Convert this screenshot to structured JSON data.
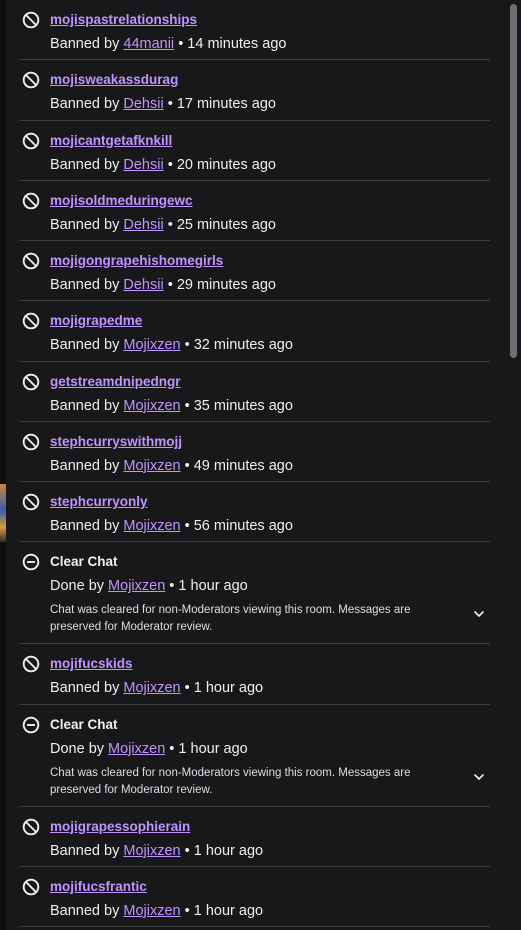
{
  "log": {
    "entries": [
      {
        "type": "ban",
        "icon": "ban-icon",
        "target": "mojispastrelationships",
        "action": "Banned by",
        "moderator": "44manii",
        "time": "14 minutes ago"
      },
      {
        "type": "ban",
        "icon": "ban-icon",
        "target": "mojisweakassdurag",
        "action": "Banned by",
        "moderator": "Dehsii",
        "time": "17 minutes ago"
      },
      {
        "type": "ban",
        "icon": "ban-icon",
        "target": "mojicantgetafknkill",
        "action": "Banned by",
        "moderator": "Dehsii",
        "time": "20 minutes ago"
      },
      {
        "type": "ban",
        "icon": "ban-icon",
        "target": "mojisoldmeduringewc",
        "action": "Banned by",
        "moderator": "Dehsii",
        "time": "25 minutes ago"
      },
      {
        "type": "ban",
        "icon": "ban-icon",
        "target": "mojigongrapehishomegirls",
        "action": "Banned by",
        "moderator": "Dehsii",
        "time": "29 minutes ago"
      },
      {
        "type": "ban",
        "icon": "ban-icon",
        "target": "mojigrapedme",
        "action": "Banned by",
        "moderator": "Mojixzen",
        "time": "32 minutes ago"
      },
      {
        "type": "ban",
        "icon": "ban-icon",
        "target": "getstreamdnipedngr",
        "action": "Banned by",
        "moderator": "Mojixzen",
        "time": "35 minutes ago"
      },
      {
        "type": "ban",
        "icon": "ban-icon",
        "target": "stephcurryswithmojj",
        "action": "Banned by",
        "moderator": "Mojixzen",
        "time": "49 minutes ago"
      },
      {
        "type": "ban",
        "icon": "ban-icon",
        "target": "stephcurryonly",
        "action": "Banned by",
        "moderator": "Mojixzen",
        "time": "56 minutes ago"
      },
      {
        "type": "clear",
        "icon": "clear-chat-icon",
        "target": "Clear Chat",
        "action": "Done by",
        "moderator": "Mojixzen",
        "time": "1 hour ago",
        "description": "Chat was cleared for non-Moderators viewing this room. Messages are preserved for Moderator review."
      },
      {
        "type": "ban",
        "icon": "ban-icon",
        "target": "mojifucskids",
        "action": "Banned by",
        "moderator": "Mojixzen",
        "time": "1 hour ago"
      },
      {
        "type": "clear",
        "icon": "clear-chat-icon",
        "target": "Clear Chat",
        "action": "Done by",
        "moderator": "Mojixzen",
        "time": "1 hour ago",
        "description": "Chat was cleared for non-Moderators viewing this room. Messages are preserved for Moderator review."
      },
      {
        "type": "ban",
        "icon": "ban-icon",
        "target": "mojigrapessophierain",
        "action": "Banned by",
        "moderator": "Mojixzen",
        "time": "1 hour ago"
      },
      {
        "type": "ban",
        "icon": "ban-icon",
        "target": "mojifucsfrantic",
        "action": "Banned by",
        "moderator": "Mojixzen",
        "time": "1 hour ago"
      }
    ]
  },
  "colors": {
    "background": "#18181b",
    "link": "#bf94ff",
    "text": "#efeff1",
    "divider": "#3a3a3d"
  }
}
